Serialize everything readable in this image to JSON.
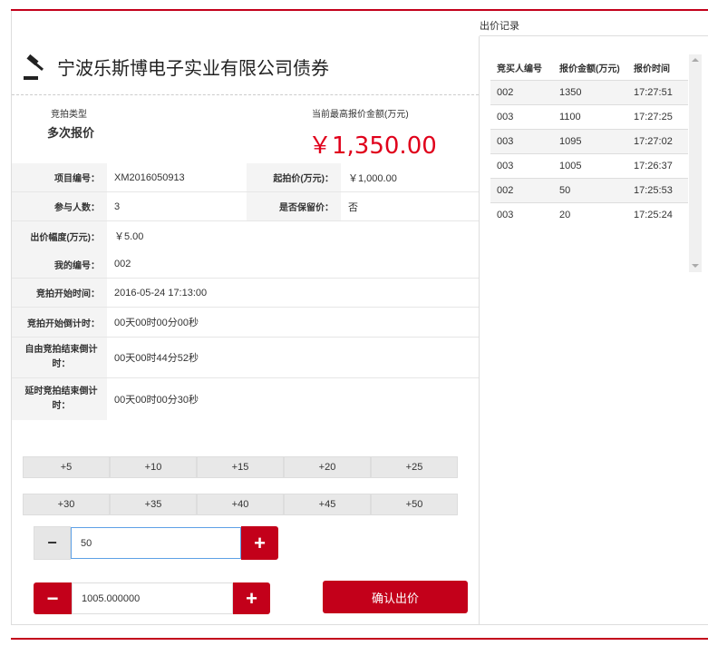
{
  "right_panel": {
    "header": "出价记录",
    "columns": [
      "竞买人编号",
      "报价金额(万元)",
      "报价时间"
    ],
    "rows": [
      {
        "bidder": "002",
        "amount": "1350",
        "time": "17:27:51"
      },
      {
        "bidder": "003",
        "amount": "1100",
        "time": "17:27:25"
      },
      {
        "bidder": "003",
        "amount": "1095",
        "time": "17:27:02"
      },
      {
        "bidder": "003",
        "amount": "1005",
        "time": "17:26:37"
      },
      {
        "bidder": "002",
        "amount": "50",
        "time": "17:25:53"
      },
      {
        "bidder": "003",
        "amount": "20",
        "time": "17:25:24"
      }
    ]
  },
  "title": "宁波乐斯博电子实业有限公司债券",
  "auction_type": {
    "label": "竞拍类型",
    "value": "多次报价"
  },
  "current_price": {
    "label": "当前最高报价金额(万元)",
    "value": "￥1,350.00"
  },
  "info": {
    "project_no_label": "项目编号：",
    "project_no": "XM2016050913",
    "start_price_label": "起拍价(万元)：",
    "start_price": "￥1,000.00",
    "participants_label": "参与人数：",
    "participants": "3",
    "reserve_label": "是否保留价：",
    "reserve": "否",
    "increment_label": "出价幅度(万元)：",
    "increment": "￥5.00",
    "my_no_label": "我的编号：",
    "my_no": "002",
    "start_time_label": "竞拍开始时间：",
    "start_time": "2016-05-24 17:13:00",
    "start_countdown_label": "竞拍开始倒计时：",
    "start_countdown": "00天00时00分00秒",
    "free_end_label": "自由竞拍结束倒计时：",
    "free_end": "00天00时44分52秒",
    "delay_end_label": "延时竞拍结束倒计时：",
    "delay_end": "00天00时00分30秒"
  },
  "increments_row1": [
    "+5",
    "+10",
    "+15",
    "+20",
    "+25"
  ],
  "increments_row2": [
    "+30",
    "+35",
    "+40",
    "+45",
    "+50"
  ],
  "step_input": {
    "value": "50",
    "minus": "−",
    "plus": "+"
  },
  "bid_input": {
    "value": "1005.000000",
    "minus": "−",
    "plus": "+"
  },
  "confirm_label": "确认出价",
  "colors": {
    "accent": "#c3001a",
    "price": "#e0001b"
  }
}
